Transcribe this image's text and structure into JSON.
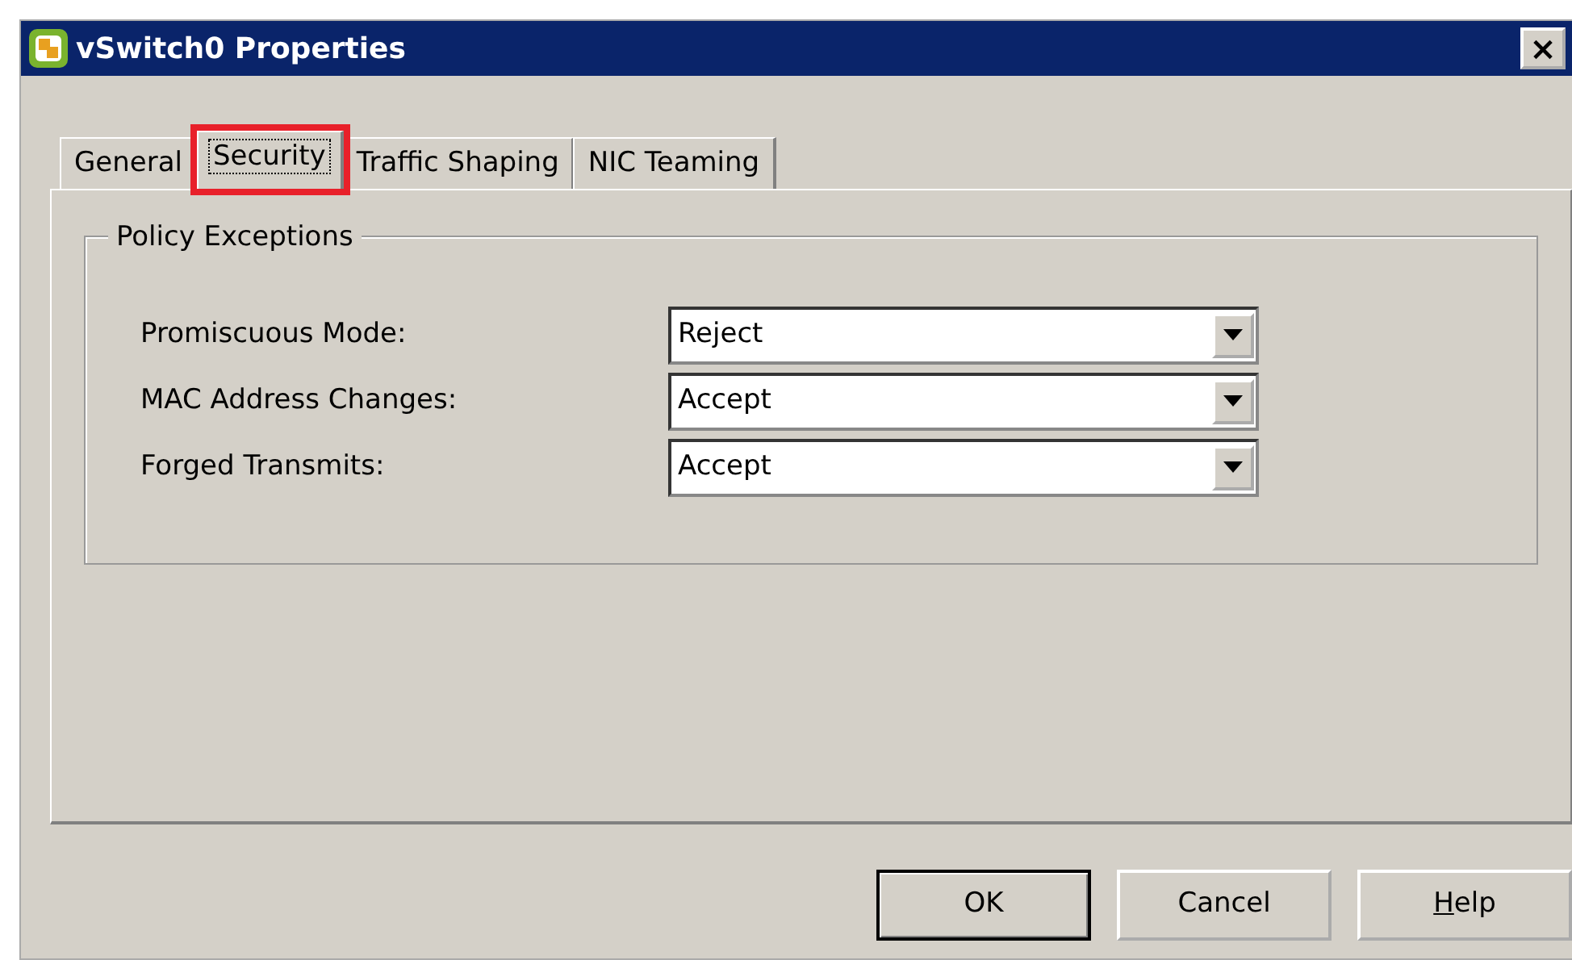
{
  "window": {
    "title": "vSwitch0 Properties",
    "close": "×"
  },
  "tabs": [
    {
      "label": "General",
      "selected": false,
      "highlighted": false
    },
    {
      "label": "Security",
      "selected": true,
      "highlighted": true
    },
    {
      "label": "Traffic Shaping",
      "selected": false,
      "highlighted": false
    },
    {
      "label": "NIC Teaming",
      "selected": false,
      "highlighted": false
    }
  ],
  "group": {
    "title": "Policy Exceptions",
    "fields": [
      {
        "label": "Promiscuous Mode:",
        "value": "Reject"
      },
      {
        "label": "MAC Address Changes:",
        "value": "Accept"
      },
      {
        "label": "Forged Transmits:",
        "value": "Accept"
      }
    ]
  },
  "buttons": [
    {
      "label": "OK",
      "default": true,
      "underline_first": false
    },
    {
      "label": "Cancel",
      "default": false,
      "underline_first": false
    },
    {
      "label": "Help",
      "default": false,
      "underline_first": true
    }
  ]
}
